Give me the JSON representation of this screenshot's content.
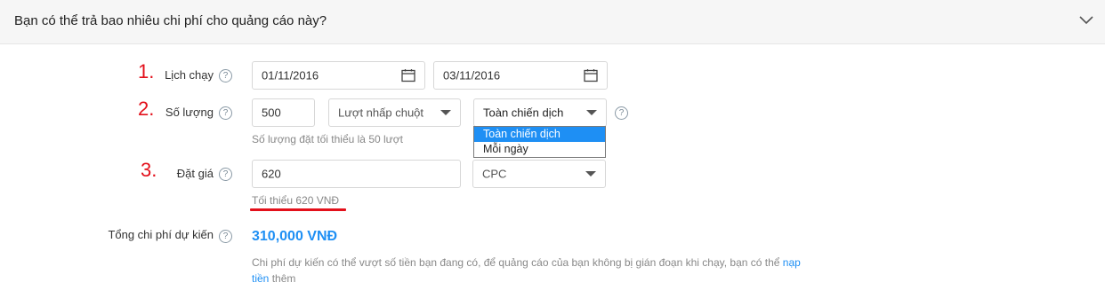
{
  "header": {
    "title": "Bạn có thể trả bao nhiêu chi phí cho quảng cáo này?",
    "collapse_icon": "chevron-down-icon"
  },
  "schedule": {
    "number": "1.",
    "label": "Lịch chạy",
    "start_date": "01/11/2016",
    "end_date": "03/11/2016"
  },
  "quantity": {
    "number": "2.",
    "label": "Số lượng",
    "value": "500",
    "unit_select": "Lượt nhấp chuột",
    "scope_select": "Toàn chiến dịch",
    "scope_options": [
      "Toàn chiến dịch",
      "Mỗi ngày"
    ],
    "hint": "Số lượng đặt tối thiểu là 50 lượt"
  },
  "bid": {
    "number": "3.",
    "label": "Đặt giá",
    "value": "620",
    "type_select": "CPC",
    "hint": "Tối thiểu 620 VNĐ"
  },
  "total": {
    "label": "Tổng chi phí dự kiến",
    "value": "310,000 VNĐ",
    "note_before": "Chi phí dự kiến có thể vượt số tiền bạn đang có, để quảng cáo của bạn không bị gián đoạn khi chạy, bạn có thể ",
    "note_link": "nạp tiền",
    "note_after": " thêm"
  },
  "help_glyph": "?",
  "colors": {
    "accent": "#1e8ff4",
    "annotation_red": "#e3101b"
  }
}
